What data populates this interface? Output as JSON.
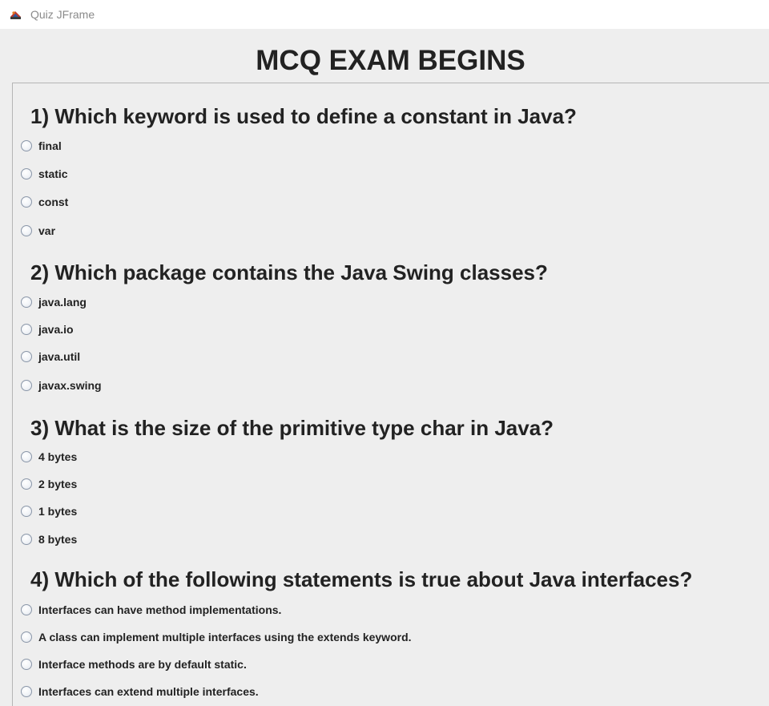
{
  "window": {
    "title": "Quiz JFrame",
    "icon": "java-coffee-icon"
  },
  "exam": {
    "header": "MCQ EXAM BEGINS",
    "questions": [
      {
        "text": "1) Which keyword is used to define a constant in Java?",
        "options": [
          "final",
          "static",
          "const",
          "var"
        ]
      },
      {
        "text": "2) Which package contains the Java Swing classes?",
        "options": [
          "java.lang",
          "java.io",
          "java.util",
          "javax.swing"
        ]
      },
      {
        "text": "3) What is the size of the primitive type char in Java?",
        "options": [
          "4 bytes",
          "2 bytes",
          "1 bytes",
          "8 bytes"
        ]
      },
      {
        "text": "4) Which of the following statements is true about Java interfaces?",
        "options": [
          "Interfaces can have method implementations.",
          "A class can implement multiple interfaces using the extends keyword.",
          "Interface methods are by default static.",
          "Interfaces can extend multiple interfaces."
        ]
      }
    ]
  }
}
